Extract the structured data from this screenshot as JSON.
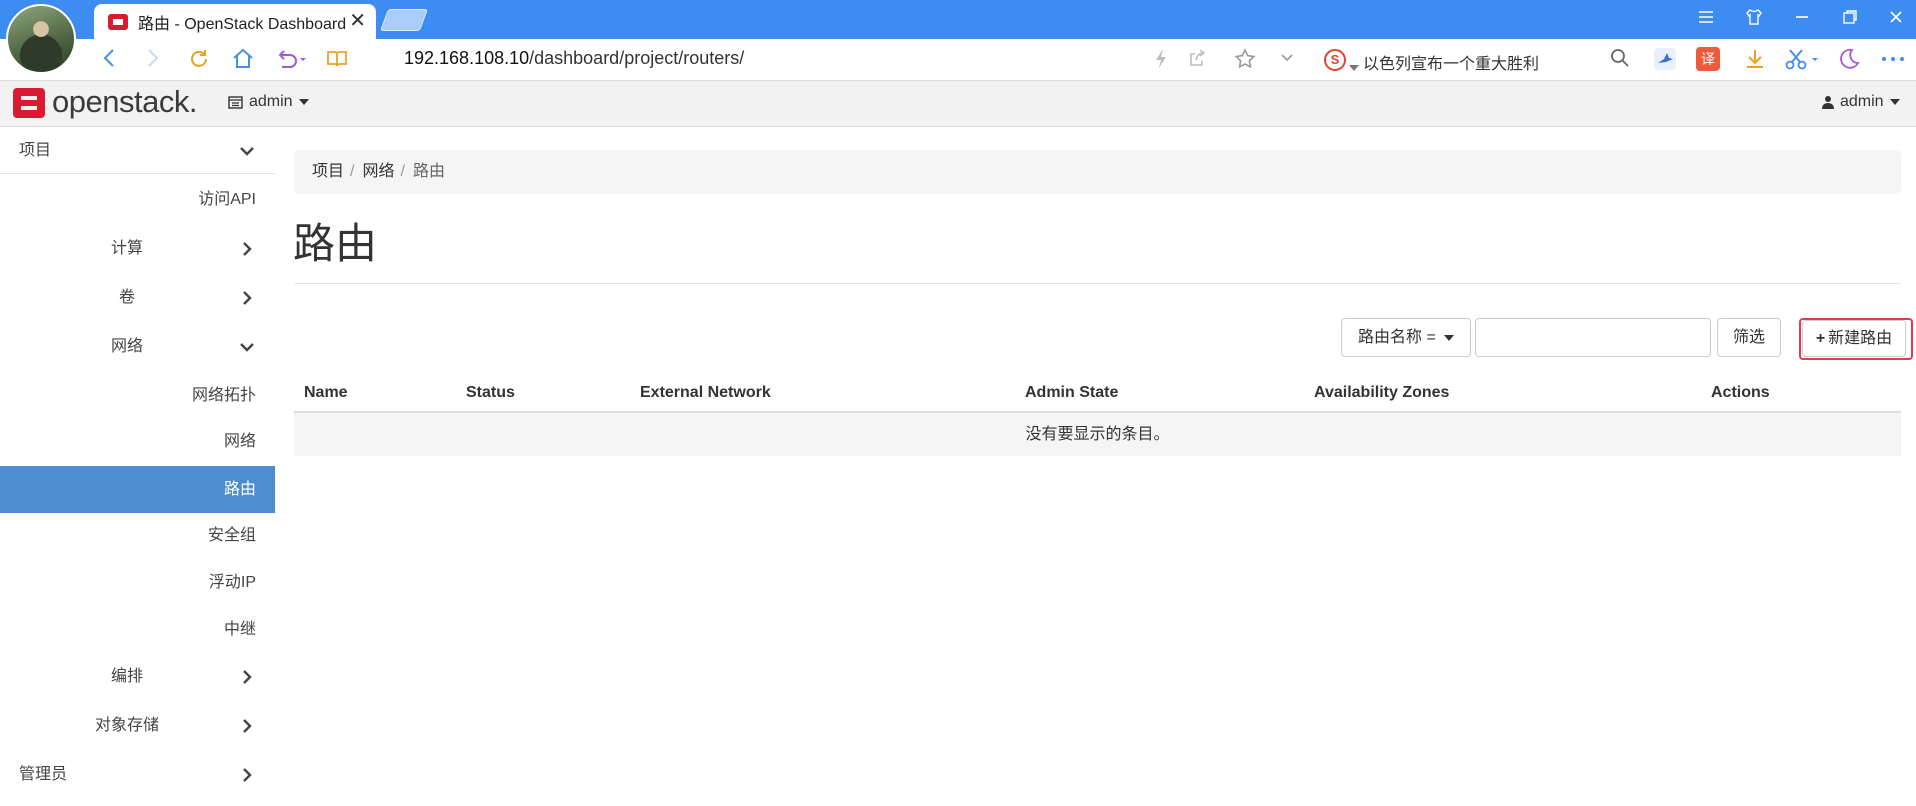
{
  "browser": {
    "tab_title": "路由 - OpenStack Dashboard",
    "tab_close": "✕",
    "url_host": "192.168.108.10",
    "url_path": "/dashboard/project/routers/",
    "search_engine_glyph": "S",
    "search_text": "以色列宣布一个重大胜利",
    "icons": [
      "back-icon",
      "forward-icon",
      "reload-icon",
      "home-icon",
      "undo-icon",
      "reader-icon",
      "lightning-icon",
      "share-icon",
      "star-icon",
      "chevron-down-icon",
      "search-icon",
      "bird-icon",
      "translate-icon",
      "download-icon",
      "scissors-icon",
      "moon-icon",
      "more-icon"
    ]
  },
  "header": {
    "logo_text": "openstack.",
    "project": "admin",
    "user": "admin"
  },
  "sidebar": {
    "project": "项目",
    "access_api": "访问API",
    "compute": "计算",
    "volumes": "卷",
    "network": "网络",
    "network_topology": "网络拓扑",
    "networks": "网络",
    "routers": "路由",
    "security_groups": "安全组",
    "floating_ips": "浮动IP",
    "trunks": "中继",
    "orchestration": "编排",
    "object_store": "对象存储",
    "admin": "管理员"
  },
  "main": {
    "breadcrumb": [
      "项目",
      "网络",
      "路由"
    ],
    "title": "路由",
    "filter_field": "路由名称 =",
    "filter_value": "",
    "filter_button": "筛选",
    "create_button": "新建路由",
    "table": {
      "columns": [
        "Name",
        "Status",
        "External Network",
        "Admin State",
        "Availability Zones",
        "Actions"
      ],
      "empty_message": "没有要显示的条目。"
    }
  },
  "colors": {
    "browser_blue": "#3d8cf1",
    "openstack_red": "#da1a32",
    "active_nav": "#4d8ccf",
    "highlight_box": "#e23b4f"
  }
}
